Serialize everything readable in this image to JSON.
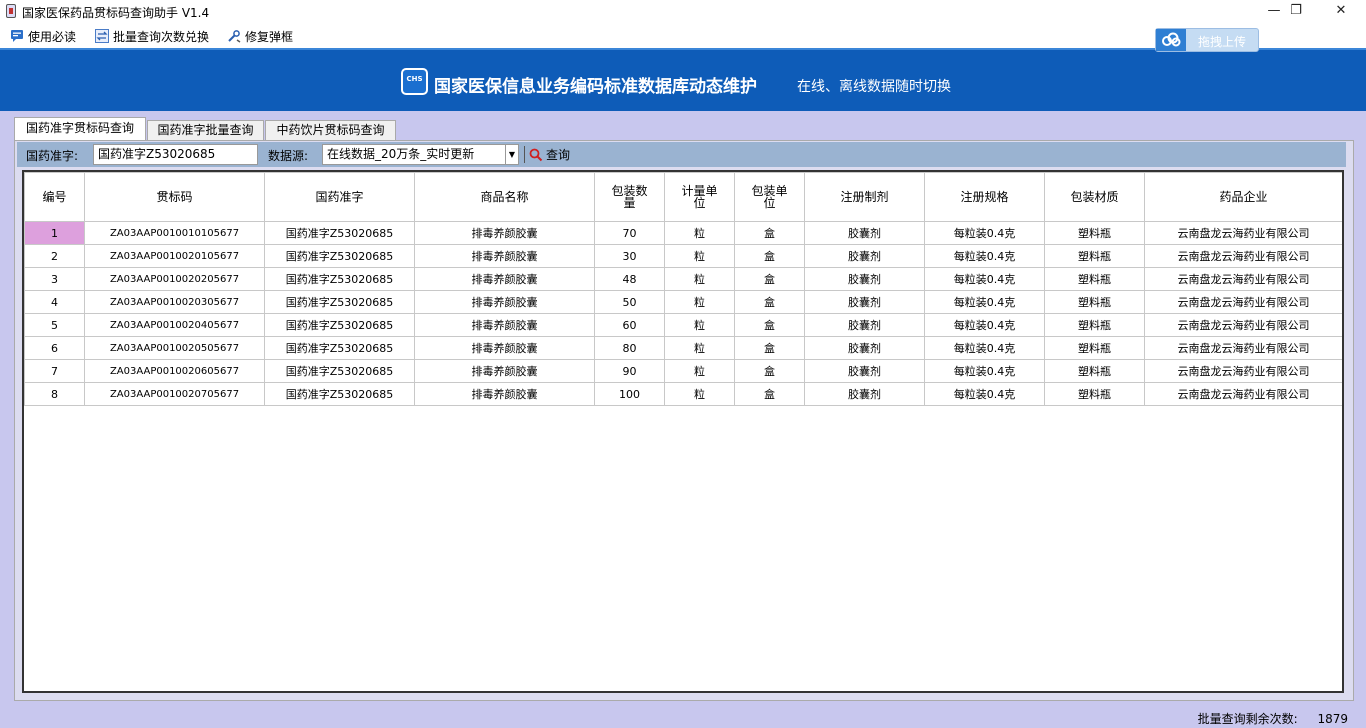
{
  "window": {
    "title": "国家医保药品贯标码查询助手 V1.4",
    "minimize_glyph": "—",
    "restore_glyph": "❐",
    "close_glyph": "✕"
  },
  "menu": {
    "items": [
      {
        "label": "使用必读",
        "icon": "chat-icon"
      },
      {
        "label": "批量查询次数兑换",
        "icon": "exchange-icon"
      },
      {
        "label": "修复弹框",
        "icon": "wrench-icon"
      }
    ]
  },
  "banner": {
    "logo_text": "CHS",
    "title": "国家医保信息业务编码标准数据库动态维护",
    "subtitle": "在线、离线数据随时切换",
    "upload_label": "拖拽上传"
  },
  "tabs": [
    {
      "label": "国药准字贯标码查询",
      "active": true
    },
    {
      "label": "国药准字批量查询",
      "active": false
    },
    {
      "label": "中药饮片贯标码查询",
      "active": false
    }
  ],
  "search": {
    "approval_label": "国药准字:",
    "approval_value": "国药准字Z53020685",
    "source_label": "数据源:",
    "source_value": "在线数据_20万条_实时更新",
    "query_label": "查询"
  },
  "table": {
    "headers": [
      "编号",
      "贯标码",
      "国药准字",
      "商品名称",
      "包装数量",
      "计量单位",
      "包装单位",
      "注册制剂",
      "注册规格",
      "包装材质",
      "药品企业"
    ],
    "rows": [
      [
        "1",
        "ZA03AAP0010010105677",
        "国药准字Z53020685",
        "排毒养颜胶囊",
        "70",
        "粒",
        "盒",
        "胶囊剂",
        "每粒装0.4克",
        "塑料瓶",
        "云南盘龙云海药业有限公司"
      ],
      [
        "2",
        "ZA03AAP0010020105677",
        "国药准字Z53020685",
        "排毒养颜胶囊",
        "30",
        "粒",
        "盒",
        "胶囊剂",
        "每粒装0.4克",
        "塑料瓶",
        "云南盘龙云海药业有限公司"
      ],
      [
        "3",
        "ZA03AAP0010020205677",
        "国药准字Z53020685",
        "排毒养颜胶囊",
        "48",
        "粒",
        "盒",
        "胶囊剂",
        "每粒装0.4克",
        "塑料瓶",
        "云南盘龙云海药业有限公司"
      ],
      [
        "4",
        "ZA03AAP0010020305677",
        "国药准字Z53020685",
        "排毒养颜胶囊",
        "50",
        "粒",
        "盒",
        "胶囊剂",
        "每粒装0.4克",
        "塑料瓶",
        "云南盘龙云海药业有限公司"
      ],
      [
        "5",
        "ZA03AAP0010020405677",
        "国药准字Z53020685",
        "排毒养颜胶囊",
        "60",
        "粒",
        "盒",
        "胶囊剂",
        "每粒装0.4克",
        "塑料瓶",
        "云南盘龙云海药业有限公司"
      ],
      [
        "6",
        "ZA03AAP0010020505677",
        "国药准字Z53020685",
        "排毒养颜胶囊",
        "80",
        "粒",
        "盒",
        "胶囊剂",
        "每粒装0.4克",
        "塑料瓶",
        "云南盘龙云海药业有限公司"
      ],
      [
        "7",
        "ZA03AAP0010020605677",
        "国药准字Z53020685",
        "排毒养颜胶囊",
        "90",
        "粒",
        "盒",
        "胶囊剂",
        "每粒装0.4克",
        "塑料瓶",
        "云南盘龙云海药业有限公司"
      ],
      [
        "8",
        "ZA03AAP0010020705677",
        "国药准字Z53020685",
        "排毒养颜胶囊",
        "100",
        "粒",
        "盒",
        "胶囊剂",
        "每粒装0.4克",
        "塑料瓶",
        "云南盘龙云海药业有限公司"
      ]
    ]
  },
  "status": {
    "remaining_label": "批量查询剩余次数:",
    "remaining_value": "1879"
  },
  "colors": {
    "banner_bg": "#0e5cb8",
    "page_bg": "#c8c7ee",
    "searchbar_bg": "#9ab3d1",
    "selected_cell": "#dda0dd"
  }
}
